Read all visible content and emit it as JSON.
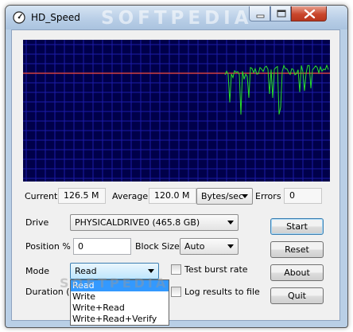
{
  "window": {
    "title": "HD_Speed",
    "watermark": "SOFTPEDIA"
  },
  "stats": {
    "current_label": "Current",
    "current_value": "126.5 M",
    "average_label": "Average",
    "average_value": "120.0 M",
    "unit_selected": "Bytes/sec",
    "errors_label": "Errors",
    "errors_value": "0"
  },
  "form": {
    "drive_label": "Drive",
    "drive_value": "PHYSICALDRIVE0 (465.8 GB)",
    "position_label": "Position %",
    "position_value": "0",
    "blocksize_label": "Block Size",
    "blocksize_value": "Auto",
    "mode_label": "Mode",
    "mode_value": "Read",
    "duration_label": "Duration (",
    "test_burst_label": "Test burst rate",
    "log_results_label": "Log results to file",
    "mode_options": [
      "Read",
      "Write",
      "Write+Read",
      "Write+Read+Verify"
    ]
  },
  "buttons": {
    "start": "Start",
    "reset": "Reset",
    "about": "About",
    "quit": "Quit"
  },
  "colors": {
    "graph_bg": "#00004a",
    "grid": "#1c1ca8",
    "average_line": "#d04040",
    "speed_trace": "#28e028"
  }
}
